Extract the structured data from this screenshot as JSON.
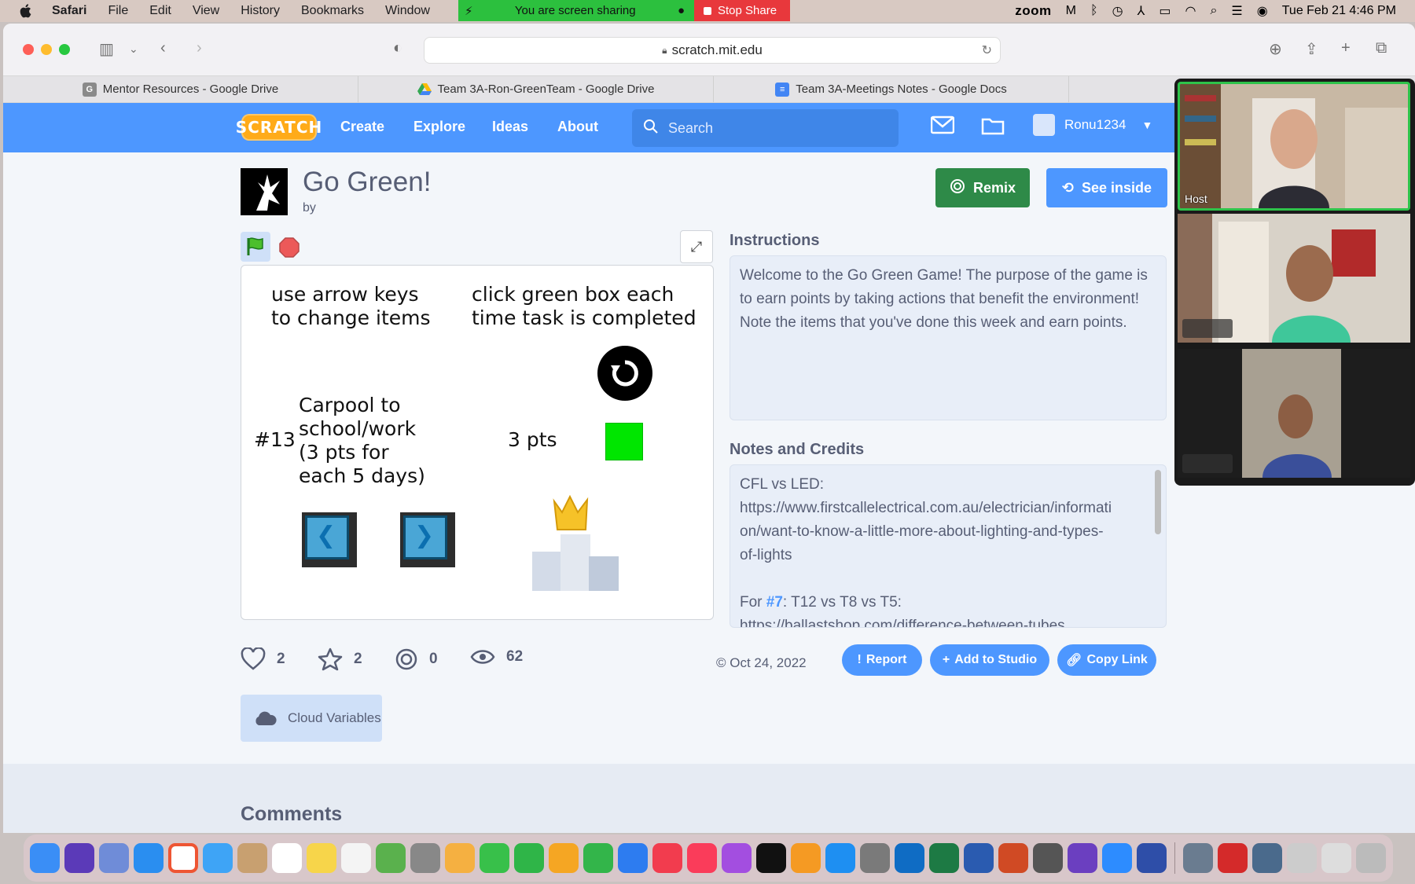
{
  "menubar": {
    "app": "Safari",
    "items": [
      "File",
      "Edit",
      "View",
      "History",
      "Bookmarks",
      "Window"
    ],
    "sharing_banner": "You are screen sharing",
    "stop_share": "Stop Share",
    "zoom_label": "zoom",
    "datetime": "Tue Feb 21  4:46 PM"
  },
  "browser": {
    "url": "scratch.mit.edu",
    "tabs": [
      {
        "label": "Mentor Resources - Google Drive",
        "icon": "google-drive-icon"
      },
      {
        "label": "Team 3A-Ron-GreenTeam - Google Drive",
        "icon": "google-drive-icon"
      },
      {
        "label": "Team 3A-Meetings Notes - Google Docs",
        "icon": "google-docs-icon"
      }
    ]
  },
  "scratch_nav": {
    "logo": "SCRATCH",
    "links": [
      "Create",
      "Explore",
      "Ideas",
      "About"
    ],
    "search_placeholder": "Search",
    "username": "Ronu1234"
  },
  "project": {
    "title": "Go Green!",
    "by": "by",
    "remix_label": "Remix",
    "see_inside_label": "See inside",
    "stage": {
      "hint_left": [
        "use arrow keys",
        "to change items"
      ],
      "hint_right": [
        "click green box each",
        "time task is completed"
      ],
      "item_number": "#13",
      "item_text": [
        "Carpool to",
        "school/work",
        "(3 pts for",
        "each 5 days)"
      ],
      "points": "3 pts",
      "box_color": "#00e600"
    },
    "instructions_heading": "Instructions",
    "instructions": "Welcome to the Go Green Game! The purpose of the game is to earn points by taking actions that benefit the environment! Note the items that you've done this week and earn points.",
    "notes_heading": "Notes and Credits",
    "notes_lines": [
      "CFL vs LED:",
      "https://www.firstcallelectrical.com.au/electrician/informati",
      "on/want-to-know-a-little-more-about-lighting-and-types-",
      "of-lights"
    ],
    "notes_for_prefix": "For ",
    "notes_for_link": "#7",
    "notes_for_suffix": ": T12 vs T8 vs T5:",
    "notes_cut": "https://ballastshop.com/difference-between-tubes",
    "stats": {
      "loves": "2",
      "favorites": "2",
      "remixes": "0",
      "views": "62"
    },
    "date": "Oct 24, 2022",
    "report_label": "Report",
    "add_studio_label": "Add to Studio",
    "copy_link_label": "Copy Link",
    "cloud_label": "Cloud Variables",
    "comments_heading": "Comments"
  },
  "zoom": {
    "host_label": "Host"
  }
}
